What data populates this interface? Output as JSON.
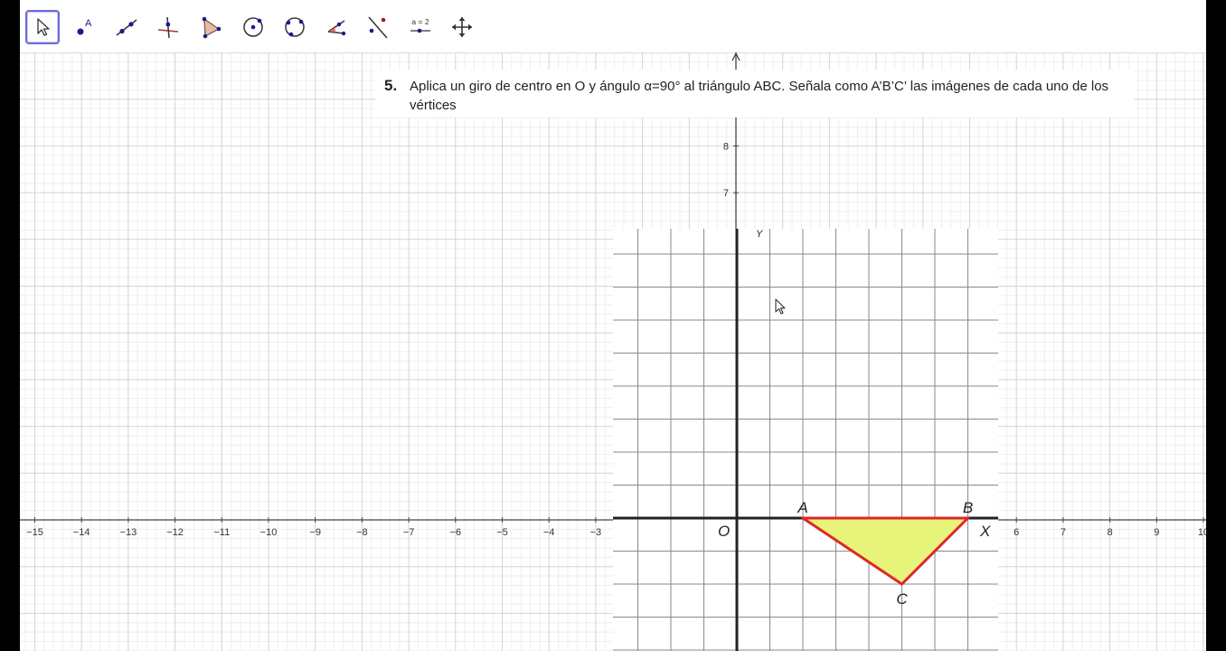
{
  "toolbar": {
    "tools": [
      {
        "name": "move-tool",
        "icon": "arrow-pointer-icon"
      },
      {
        "name": "point-tool",
        "icon": "point-icon",
        "text": "A"
      },
      {
        "name": "line-tool",
        "icon": "line-through-points-icon"
      },
      {
        "name": "perpendicular-tool",
        "icon": "perpendicular-line-icon"
      },
      {
        "name": "polygon-tool",
        "icon": "polygon-icon"
      },
      {
        "name": "circle-center-tool",
        "icon": "circle-center-point-icon"
      },
      {
        "name": "circle-three-points-tool",
        "icon": "circle-three-points-icon"
      },
      {
        "name": "angle-tool",
        "icon": "angle-icon"
      },
      {
        "name": "reflect-tool",
        "icon": "reflect-about-line-icon"
      },
      {
        "name": "slider-tool",
        "icon": "slider-icon",
        "text": "a = 2"
      },
      {
        "name": "move-view-tool",
        "icon": "move-graphics-view-icon"
      }
    ],
    "selected": "move-tool"
  },
  "problem": {
    "number": "5.",
    "text": "Aplica un giro de centro en O y ángulo α=90° al triángulo ABC. Señala como A’B’C’ las imágenes de cada uno de los vértices"
  },
  "graphics": {
    "x_tick_labels": [
      "−15",
      "−14",
      "−13",
      "−12",
      "−11",
      "−10",
      "−9",
      "−8",
      "−7",
      "−6",
      "−5",
      "−4",
      "−3",
      "6",
      "7",
      "8",
      "9",
      "10"
    ],
    "y_tick_labels": [
      "8",
      "7"
    ]
  },
  "worksheet": {
    "origin_label": "O",
    "x_axis_label": "X",
    "y_axis_label": "Y",
    "vertices": [
      {
        "label": "A",
        "x": 2,
        "y": 0
      },
      {
        "label": "B",
        "x": 7,
        "y": 0
      },
      {
        "label": "C",
        "x": 5,
        "y": -2
      }
    ],
    "triangle_fill": "#e8f37a",
    "triangle_stroke": "#e0262a"
  }
}
